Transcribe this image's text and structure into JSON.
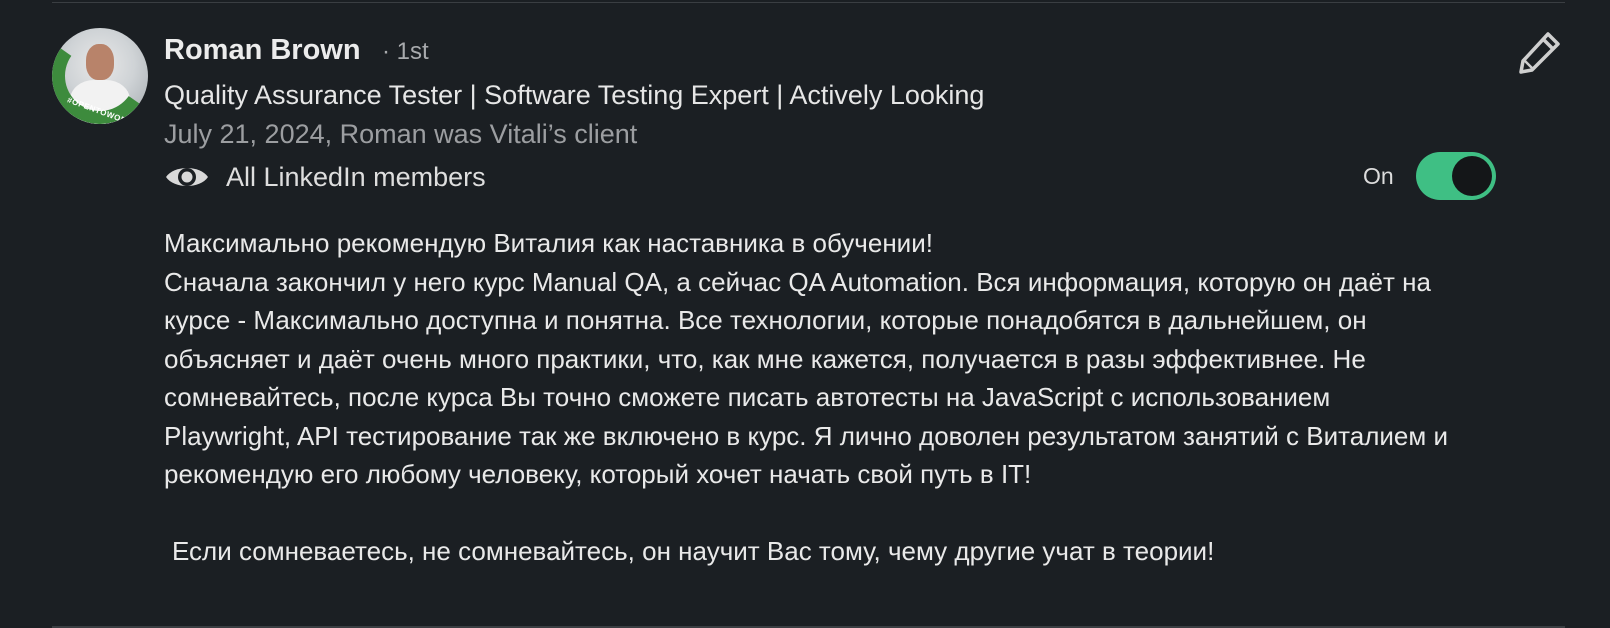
{
  "recommendation": {
    "avatar_badge": "#OPENTOWORK",
    "name": "Roman Brown",
    "degree": "· 1st",
    "headline": "Quality Assurance Tester | Software Testing Expert | Actively Looking",
    "meta": "July 21, 2024, Roman was Vitali’s client",
    "visibility_label": "All LinkedIn members",
    "visibility_icon": "eye-icon",
    "toggle_label": "On",
    "toggle_state": true,
    "edit_icon": "pencil-icon",
    "accent_color": "#3fbf84",
    "paragraphs": [
      "Максимально рекомендую Виталия как наставника в обучении!",
      "Сначала закончил у него курс Manual QA, а сейчас QA Automation. Вся информация, которую он даёт на курсе - Максимально доступна и понятна. Все технологии, которые понадобятся в дальнейшем, он объясняет и даёт очень много практики, что, как мне кажется, получается в разы эффективнее. Не сомневайтесь, после курса Вы точно сможете писать автотесты на JavaScript с использованием Playwright, API тестирование так же включено в курс. Я лично доволен результатом занятий с Виталием и рекомендую его любому человеку, который хочет начать свой путь в IT!",
      "Если сомневаетесь, не сомневайтесь, он научит Вас тому, чему другие учат в теории!"
    ]
  }
}
